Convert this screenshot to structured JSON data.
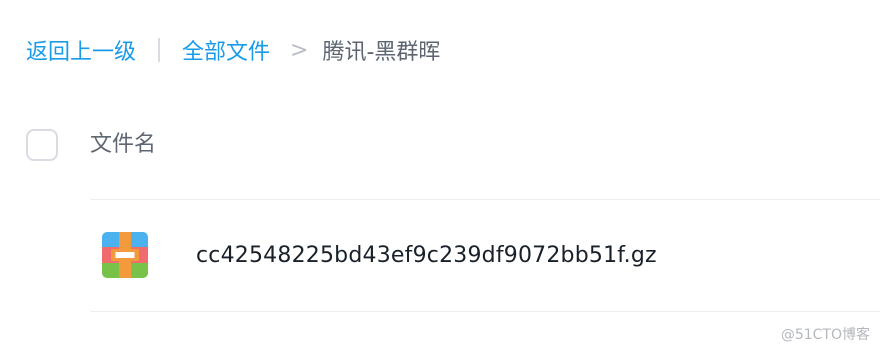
{
  "breadcrumb": {
    "back_label": "返回上一级",
    "root_label": "全部文件",
    "current_label": "腾讯-黑群晖"
  },
  "file_list": {
    "header": {
      "name_column": "文件名"
    },
    "files": [
      {
        "name": "cc42548225bd43ef9c239df9072bb51f.gz",
        "icon": "archive-icon"
      }
    ]
  },
  "watermark": "@51CTO博客"
}
